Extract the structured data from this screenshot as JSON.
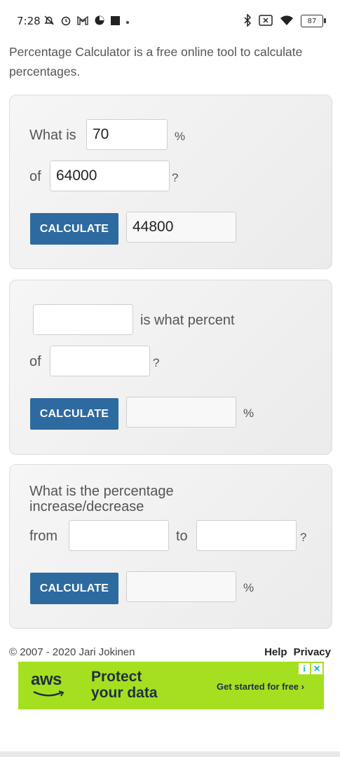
{
  "status_bar": {
    "time": "7:28",
    "battery": "87",
    "icons_left": [
      "notification-muted-icon",
      "alarm-icon",
      "gmail-icon",
      "clock-icon",
      "stop-icon",
      "dot-icon"
    ],
    "icons_right": [
      "bluetooth-icon",
      "screen-x-icon",
      "wifi-icon",
      "battery-icon"
    ]
  },
  "intro": "Percentage Calculator is a free online tool to calculate percentages.",
  "calc1": {
    "label_what_is": "What is",
    "value_percent": "70",
    "label_percent": "%",
    "label_of": "of",
    "value_of": "64000",
    "label_q": "?",
    "button": "CALCULATE",
    "result": "44800"
  },
  "calc2": {
    "value_a": "",
    "label_is_what": "is what percent",
    "label_of": "of",
    "value_b": "",
    "label_q": "?",
    "button": "CALCULATE",
    "result": "",
    "label_percent": "%"
  },
  "calc3": {
    "title_line1": "What is the percentage",
    "title_line2": "increase/decrease",
    "label_from": "from",
    "value_from": "",
    "label_to": "to",
    "value_to": "",
    "label_q": "?",
    "button": "CALCULATE",
    "result": "",
    "label_percent": "%"
  },
  "footer": {
    "copyright": "© 2007 - 2020 Jari Jokinen",
    "help": "Help",
    "privacy": "Privacy"
  },
  "ad": {
    "brand": "aws",
    "headline_line1": "Protect",
    "headline_line2": "your data",
    "cta": "Get started for free ›",
    "badge_info": "i",
    "badge_close": "✕",
    "colors": {
      "background": "#a4e01f",
      "text": "#232f3e"
    }
  },
  "colors": {
    "button": "#2d6a9f"
  }
}
